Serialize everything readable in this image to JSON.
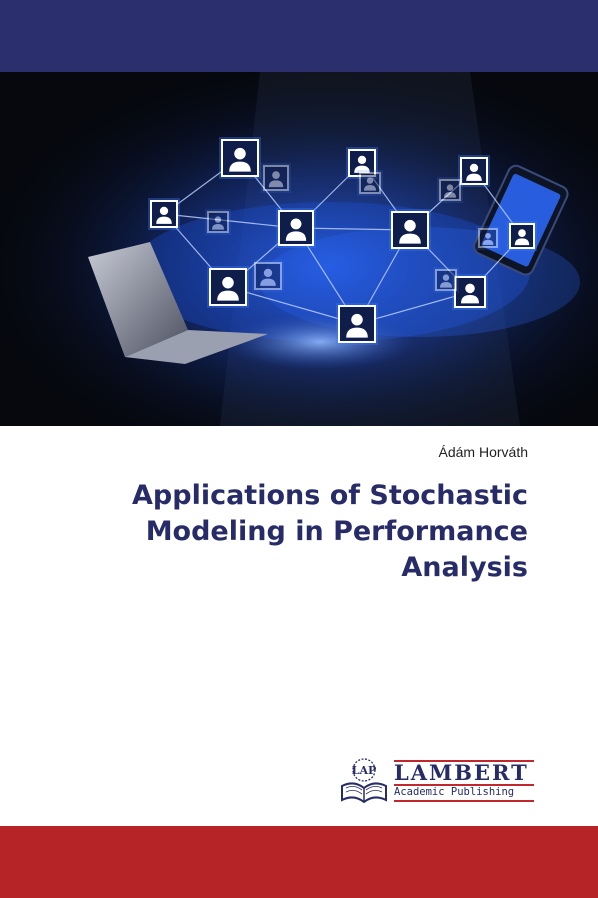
{
  "cover": {
    "author": "Ádám Horváth",
    "title_lines": [
      "Applications of Stochastic",
      "Modeling in Performance",
      "Analysis"
    ],
    "publisher": {
      "emblem_text": "LAP",
      "name": "LAMBERT",
      "subtitle": "Academic Publishing"
    },
    "colors": {
      "top_band": "#2b2f6e",
      "bottom_band": "#b72428",
      "title": "#272c68",
      "network_glow": "#3b7bff"
    },
    "illustration": {
      "subject": "network of user profile icons over a laptop and tablet",
      "icon": "user-profile-icon"
    }
  }
}
